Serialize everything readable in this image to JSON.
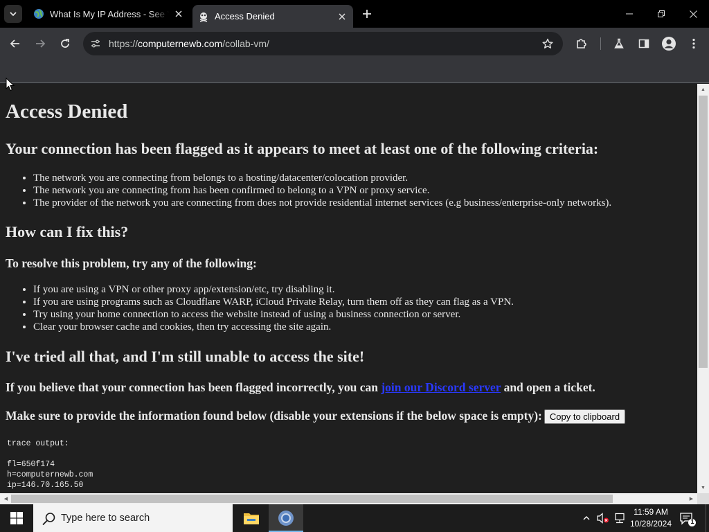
{
  "browser": {
    "tabs": [
      {
        "title": "What Is My IP Address - See Your Public IP",
        "active": false
      },
      {
        "title": "Access Denied",
        "active": true
      }
    ],
    "address": {
      "scheme": "https://",
      "host": "computernewb.com",
      "path": "/collab-vm/"
    }
  },
  "page": {
    "title": "Access Denied",
    "flagged_heading": "Your connection has been flagged as it appears to meet at least one of the following criteria:",
    "criteria": [
      "The network you are connecting from belongs to a hosting/datacenter/colocation provider.",
      "The network you are connecting from has been confirmed to belong to a VPN or proxy service.",
      "The provider of the network you are connecting from does not provide residential internet services (e.g business/enterprise-only networks)."
    ],
    "fix_heading": "How can I fix this?",
    "resolve_heading": "To resolve this problem, try any of the following:",
    "fixes": [
      "If you are using a VPN or other proxy app/extension/etc, try disabling it.",
      "If you are using programs such as Cloudflare WARP, iCloud Private Relay, turn them off as they can flag as a VPN.",
      "Try using your home connection to access the website instead of using a business connection or server.",
      "Clear your browser cache and cookies, then try accessing the site again."
    ],
    "tried_heading": "I've tried all that, and I'm still unable to access the site!",
    "incorrect_prefix": "If you believe that your connection has been flagged incorrectly, you can",
    "incorrect_link": "join our Discord server",
    "incorrect_suffix": "and open a ticket.",
    "provide_info": "Make sure to provide the information found below (disable your extensions if the below space is empty):",
    "copy_button": "Copy to clipboard",
    "trace_lines": [
      "trace output:",
      "",
      "fl=650f174",
      "h=computernewb.com",
      "ip=146.70.165.50"
    ]
  },
  "taskbar": {
    "search_placeholder": "Type here to search",
    "time": "11:59 AM",
    "date": "10/28/2024",
    "notification_count": "1"
  }
}
